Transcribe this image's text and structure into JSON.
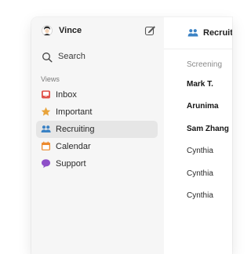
{
  "user": {
    "name": "Vince"
  },
  "search": {
    "label": "Search"
  },
  "sidebar": {
    "section_title": "Views",
    "items": [
      {
        "label": "Inbox",
        "icon": "inbox-icon",
        "color": "#e0524a",
        "active": false
      },
      {
        "label": "Important",
        "icon": "star-icon",
        "color": "#e8a33a",
        "active": false
      },
      {
        "label": "Recruiting",
        "icon": "team-icon",
        "color": "#3b82c4",
        "active": true
      },
      {
        "label": "Calendar",
        "icon": "calendar-icon",
        "color": "#ec8a2e",
        "active": false
      },
      {
        "label": "Support",
        "icon": "chat-bubble-icon",
        "color": "#8e4fc8",
        "active": false
      }
    ]
  },
  "main": {
    "title": "Recruiting",
    "group_label": "Screening",
    "rows": [
      {
        "name": "Mark T.",
        "unread": true
      },
      {
        "name": "Arunima",
        "unread": true
      },
      {
        "name": "Sam Zhang",
        "unread": true
      },
      {
        "name": "Cynthia",
        "unread": false
      },
      {
        "name": "Cynthia",
        "unread": false
      },
      {
        "name": "Cynthia",
        "unread": false
      }
    ]
  }
}
